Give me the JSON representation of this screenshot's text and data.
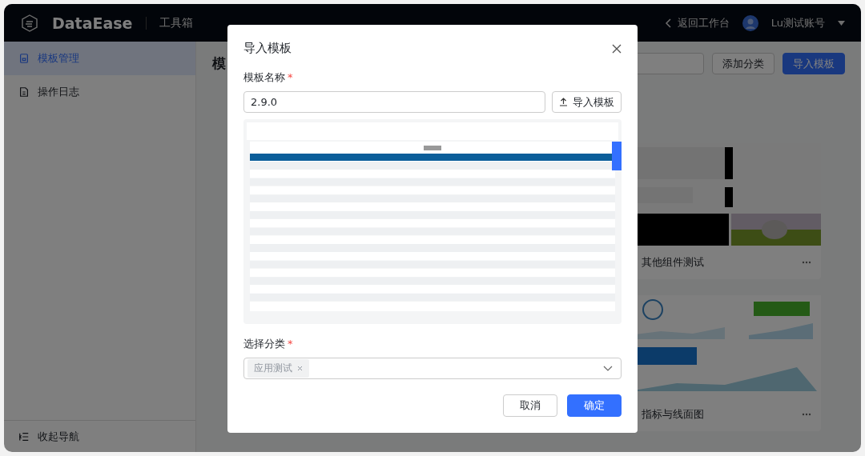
{
  "header": {
    "logo": "DataEase",
    "app_name": "工具箱",
    "back_link": "返回工作台",
    "user": "Lu测试账号"
  },
  "sidebar": {
    "items": [
      {
        "label": "模板管理",
        "selected": true
      },
      {
        "label": "操作日志",
        "selected": false
      }
    ],
    "collapse": "收起导航"
  },
  "page": {
    "title": "模",
    "buttons": [
      {
        "label": "添加分类",
        "primary": false
      },
      {
        "label": "导入模板",
        "primary": true
      }
    ],
    "cards": [
      {
        "name": "其他组件测试"
      },
      {
        "name": "指标与线面图"
      }
    ]
  },
  "dialog": {
    "title": "导入模板",
    "fields": [
      {
        "kind": "text",
        "label": "模板名称",
        "required_mark": "*",
        "value": "2.9.0",
        "button": "导入模板"
      },
      {
        "kind": "select",
        "label": "选择分类",
        "required_mark": "*",
        "tags": [
          "应用测试"
        ]
      }
    ],
    "buttons": [
      {
        "label": "取消",
        "primary": false
      },
      {
        "label": "确定",
        "primary": true
      }
    ]
  }
}
